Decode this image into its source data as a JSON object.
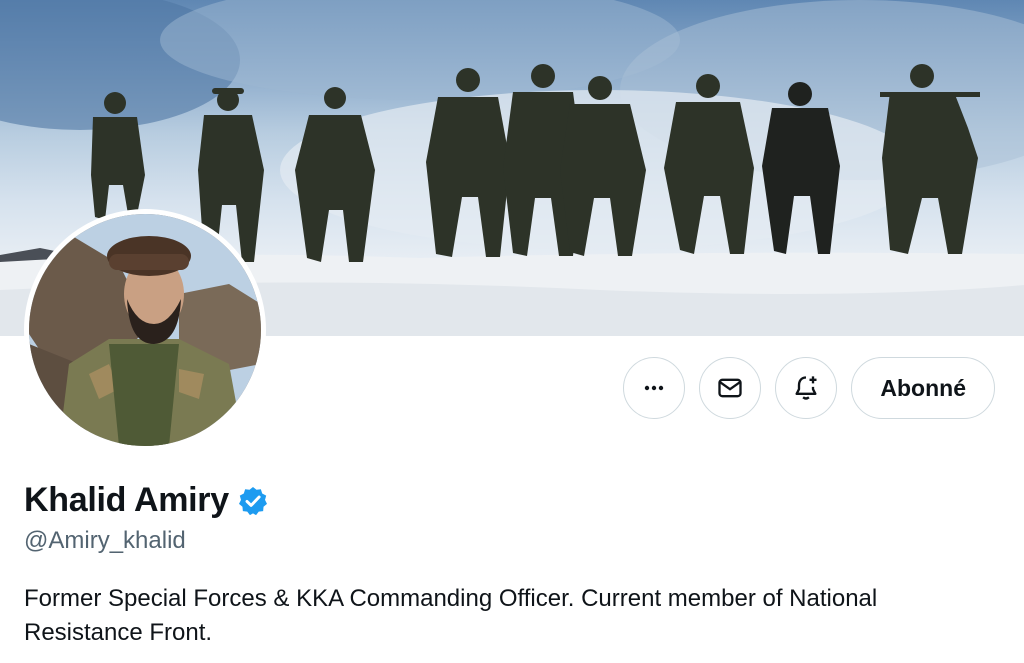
{
  "profile": {
    "display_name": "Khalid Amiry",
    "handle": "@Amiry_khalid",
    "verified": true,
    "bio": "Former Special Forces & KKA Commanding Officer. Current member of National Resistance Front."
  },
  "actions": {
    "more_icon": "more-horizontal-icon",
    "message_icon": "envelope-icon",
    "notify_icon": "bell-plus-icon",
    "follow_label": "Abonné"
  },
  "colors": {
    "verified_badge": "#1d9bf0",
    "text_primary": "#0f1419",
    "text_secondary": "#536471",
    "border": "#cfd9de"
  }
}
